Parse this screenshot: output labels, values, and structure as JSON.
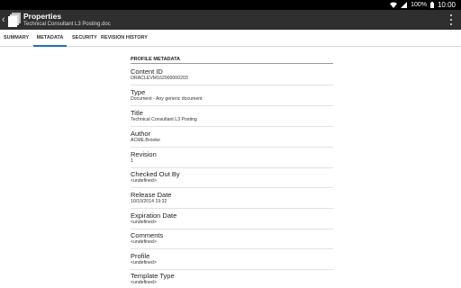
{
  "status_bar": {
    "battery": "100%",
    "time": "10:00"
  },
  "app_bar": {
    "title": "Properties",
    "subtitle": "Technical Consultant L3 Posting.doc"
  },
  "tabs": [
    {
      "label": "SUMMARY",
      "active": false
    },
    {
      "label": "METADATA",
      "active": true
    },
    {
      "label": "SECURITY",
      "active": false
    },
    {
      "label": "REVISION HISTORY",
      "active": false
    }
  ],
  "metadata": {
    "section_title": "PROFILE METADATA",
    "fields": [
      {
        "label": "Content ID",
        "value": "ORACLEVM162000000203"
      },
      {
        "label": "Type",
        "value": "Document - Any generic document"
      },
      {
        "label": "Title",
        "value": "Technical Consultant L3 Posting"
      },
      {
        "label": "Author",
        "value": "ACME.Brooke"
      },
      {
        "label": "Revision",
        "value": "1"
      },
      {
        "label": "Checked Out By",
        "value": "<undefined>"
      },
      {
        "label": "Release Date",
        "value": "10/10/2014 19:32"
      },
      {
        "label": "Expiration Date",
        "value": "<undefined>"
      },
      {
        "label": "Comments",
        "value": "<undefined>"
      },
      {
        "label": "Profile",
        "value": "<undefined>"
      },
      {
        "label": "Template Type",
        "value": "<undefined>"
      }
    ]
  }
}
